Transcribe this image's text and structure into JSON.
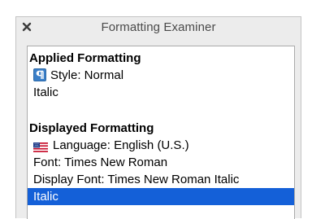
{
  "window": {
    "title": "Formatting Examiner"
  },
  "applied": {
    "heading": "Applied Formatting",
    "style": "Style: Normal",
    "italic": "Italic"
  },
  "displayed": {
    "heading": "Displayed Formatting",
    "language": "Language: English (U.S.)",
    "font": "Font: Times New Roman",
    "display_font": "Display Font: Times New Roman Italic",
    "italic": "Italic"
  },
  "icons": {
    "close": "close-icon",
    "style": "paragraph-style-icon",
    "language": "us-flag-icon"
  },
  "colors": {
    "selection": "#1460d8",
    "style_icon": "#3a7fc8"
  }
}
